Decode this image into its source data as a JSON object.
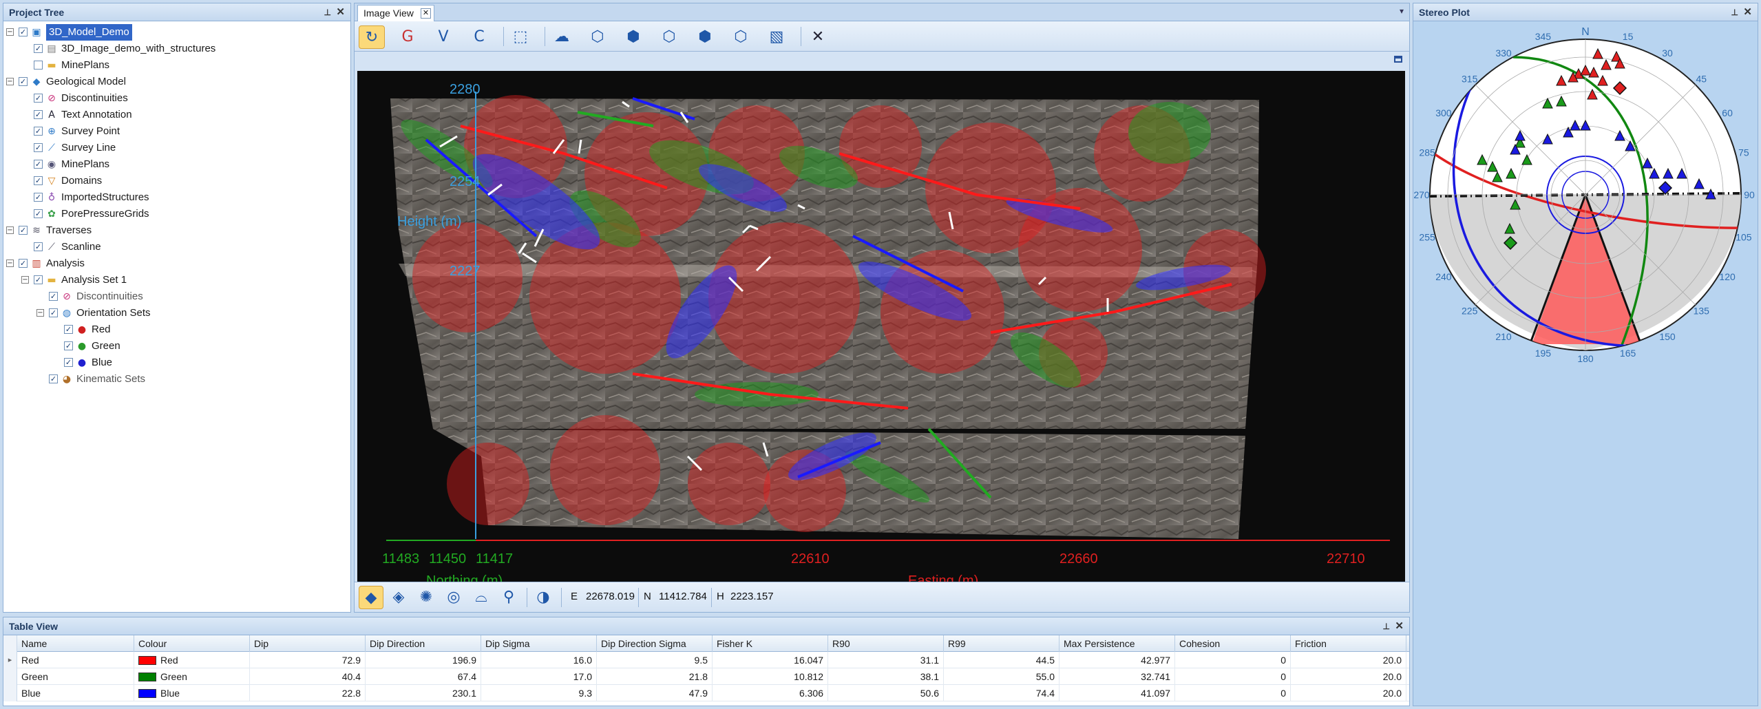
{
  "project_tree": {
    "title": "Project Tree",
    "items": [
      {
        "label": "3D_Model_Demo",
        "level": 0,
        "expander": "⊟",
        "checked": true,
        "icon": "cube-model-icon",
        "selected": true
      },
      {
        "label": "3D_Image_demo_with_structures",
        "level": 1,
        "checked": true,
        "icon": "document-icon"
      },
      {
        "label": "MinePlans",
        "level": 1,
        "checked": false,
        "icon": "folder-icon"
      },
      {
        "label": "Geological Model",
        "level": 0,
        "expander": "⊟",
        "checked": true,
        "icon": "geo-model-icon"
      },
      {
        "label": "Discontinuities",
        "level": 1,
        "checked": true,
        "icon": "discontinuity-icon"
      },
      {
        "label": "Text Annotation",
        "level": 1,
        "checked": true,
        "icon": "text-icon"
      },
      {
        "label": "Survey Point",
        "level": 1,
        "checked": true,
        "icon": "survey-point-icon"
      },
      {
        "label": "Survey Line",
        "level": 1,
        "checked": true,
        "icon": "survey-line-icon"
      },
      {
        "label": "MinePlans",
        "level": 1,
        "checked": true,
        "icon": "eye-icon"
      },
      {
        "label": "Domains",
        "level": 1,
        "checked": true,
        "icon": "domain-icon"
      },
      {
        "label": "ImportedStructures",
        "level": 1,
        "checked": true,
        "icon": "imported-icon"
      },
      {
        "label": "PorePressureGrids",
        "level": 1,
        "checked": true,
        "icon": "grid-icon"
      },
      {
        "label": "Traverses",
        "level": 0,
        "expander": "⊟",
        "checked": true,
        "icon": "traverse-icon"
      },
      {
        "label": "Scanline",
        "level": 1,
        "checked": true,
        "icon": "scanline-icon"
      },
      {
        "label": "Analysis",
        "level": 0,
        "expander": "⊟",
        "checked": true,
        "icon": "analysis-icon"
      },
      {
        "label": "Analysis Set 1",
        "level": 1,
        "expander": "⊟",
        "checked": true,
        "icon": "folder-icon"
      },
      {
        "label": "Discontinuities",
        "level": 2,
        "checked": true,
        "icon": "discontinuity-icon",
        "dim": true
      },
      {
        "label": "Orientation Sets",
        "level": 2,
        "expander": "⊟",
        "checked": true,
        "icon": "orientation-icon"
      },
      {
        "label": "Red",
        "level": 3,
        "checked": true,
        "icon": "red-dot-icon"
      },
      {
        "label": "Green",
        "level": 3,
        "checked": true,
        "icon": "green-dot-icon"
      },
      {
        "label": "Blue",
        "level": 3,
        "checked": true,
        "icon": "blue-dot-icon"
      },
      {
        "label": "Kinematic Sets",
        "level": 2,
        "checked": true,
        "icon": "kinematic-icon",
        "dim": true
      }
    ]
  },
  "image_view": {
    "tab_label": "Image View",
    "toolbar_icons": [
      "rotate-icon",
      "reset-view-icon",
      "view-v-icon",
      "view-c-icon",
      "zoom-extent-icon",
      "look-icon",
      "plane-1-icon",
      "plane-2-icon",
      "plane-3-icon",
      "plane-4-icon",
      "box-icon",
      "cube-wire-icon",
      "close-icon"
    ],
    "axes": {
      "height_label": "Height (m)",
      "height_ticks": [
        "2280",
        "2254",
        "2227"
      ],
      "northing_label": "Northing (m)",
      "northing_ticks": [
        "11483",
        "11450",
        "11417"
      ],
      "easting_label": "Easting (m)",
      "easting_ticks": [
        "22610",
        "22660",
        "22710"
      ]
    },
    "status": {
      "e_label": "E",
      "e_value": "22678.019",
      "n_label": "N",
      "n_value": "11412.784",
      "h_label": "H",
      "h_value": "2223.157"
    }
  },
  "stereo_plot": {
    "title": "Stereo Plot",
    "north_label": "N",
    "ring_labels": [
      "15",
      "30",
      "45",
      "60",
      "75",
      "90",
      "105",
      "120",
      "135",
      "150",
      "165",
      "180",
      "195",
      "210",
      "225",
      "240",
      "255",
      "270",
      "285",
      "300",
      "315",
      "330",
      "345"
    ]
  },
  "table_view": {
    "title": "Table View",
    "columns": [
      "Name",
      "Colour",
      "Dip",
      "Dip Direction",
      "Dip Sigma",
      "Dip Direction Sigma",
      "Fisher K",
      "R90",
      "R99",
      "Max Persistence",
      "Cohesion",
      "Friction"
    ],
    "rows": [
      {
        "name": "Red",
        "colour": "Red",
        "colour_hex": "#ff0000",
        "dip": "72.9",
        "dip_direction": "196.9",
        "dip_sigma": "16.0",
        "dip_direction_sigma": "9.5",
        "fisher_k": "16.047",
        "r90": "31.1",
        "r99": "44.5",
        "max_persistence": "42.977",
        "cohesion": "0",
        "friction": "20.0"
      },
      {
        "name": "Green",
        "colour": "Green",
        "colour_hex": "#008000",
        "dip": "40.4",
        "dip_direction": "67.4",
        "dip_sigma": "17.0",
        "dip_direction_sigma": "21.8",
        "fisher_k": "10.812",
        "r90": "38.1",
        "r99": "55.0",
        "max_persistence": "32.741",
        "cohesion": "0",
        "friction": "20.0"
      },
      {
        "name": "Blue",
        "colour": "Blue",
        "colour_hex": "#0000ff",
        "dip": "22.8",
        "dip_direction": "230.1",
        "dip_sigma": "9.3",
        "dip_direction_sigma": "47.9",
        "fisher_k": "6.306",
        "r90": "50.6",
        "r99": "74.4",
        "max_persistence": "41.097",
        "cohesion": "0",
        "friction": "20.0"
      }
    ]
  }
}
